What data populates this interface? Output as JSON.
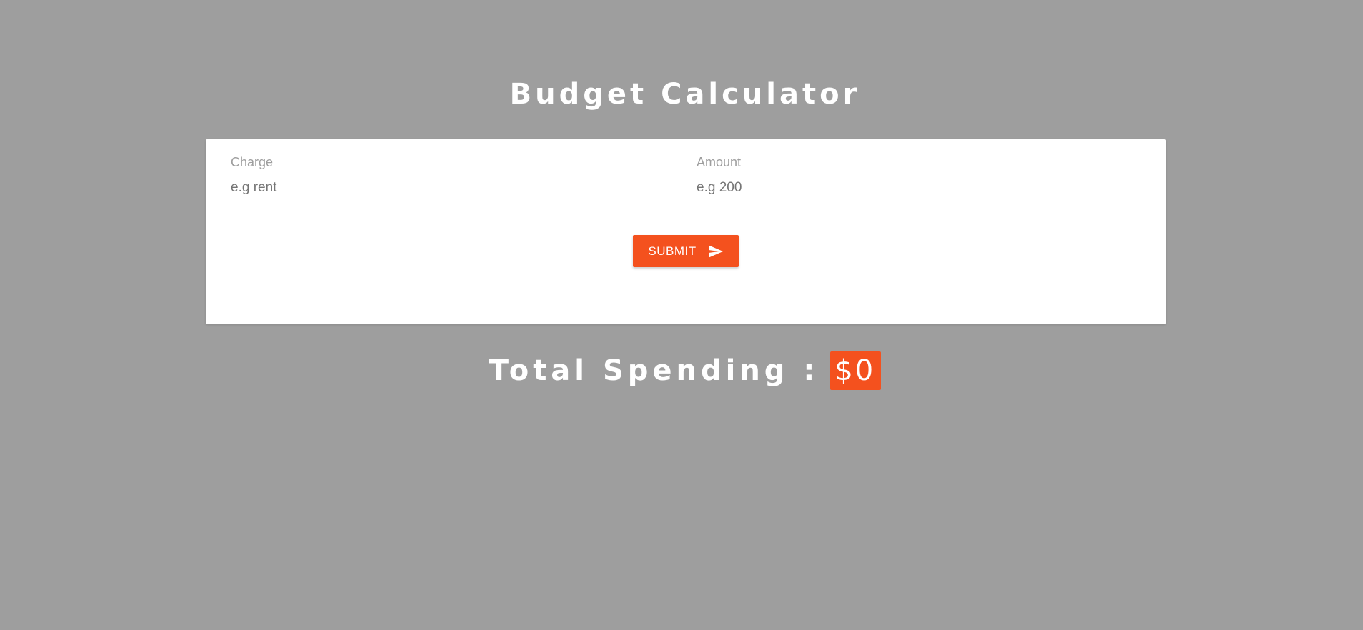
{
  "header": {
    "title": "Budget Calculator"
  },
  "form": {
    "charge": {
      "label": "Charge",
      "value": "",
      "placeholder": "e.g rent"
    },
    "amount": {
      "label": "Amount",
      "value": "",
      "placeholder": "e.g 200"
    },
    "submit": {
      "label": "SUBMIT",
      "icon": "send-icon"
    }
  },
  "total": {
    "label": "Total Spending :",
    "value": "$0"
  },
  "colors": {
    "background": "#9e9e9e",
    "accent": "#f4511e",
    "card": "#ffffff"
  }
}
